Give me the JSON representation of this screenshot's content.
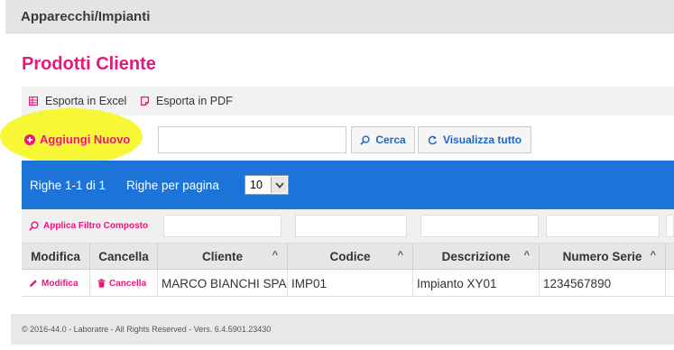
{
  "header": {
    "title": "Apparecchi/Impianti"
  },
  "page": {
    "title": "Prodotti Cliente"
  },
  "export": {
    "excel_label": "Esporta in Excel",
    "pdf_label": "Esporta in PDF"
  },
  "toolbar": {
    "add_new_label": "Aggiungi Nuovo",
    "search_value": "",
    "search_label": "Cerca",
    "show_all_label": "Visualizza tutto"
  },
  "pager": {
    "rows_text": "Righe 1-1 di 1",
    "per_page_label": "Righe per pagina",
    "per_page_value": "10"
  },
  "filter": {
    "composite_label": "Applica Filtro Composto"
  },
  "table": {
    "columns": [
      "Modifica",
      "Cancella",
      "Cliente",
      "Codice",
      "Descrizione",
      "Numero Serie"
    ],
    "rows": [
      {
        "edit_label": "Modifica",
        "delete_label": "Cancella",
        "cliente": "MARCO BIANCHI SPA",
        "codice": "IMP01",
        "descrizione": "Impianto XY01",
        "numero_serie": "1234567890"
      }
    ]
  },
  "footer": {
    "text": "© 2016-44.0 - Laboratre - All Rights Reserved - Vers. 6.4.5901.23430"
  },
  "colors": {
    "accent": "#e8177e",
    "blue_bar": "#1d74d8",
    "link_blue": "#1a66c8",
    "highlight": "#f7f72a"
  }
}
